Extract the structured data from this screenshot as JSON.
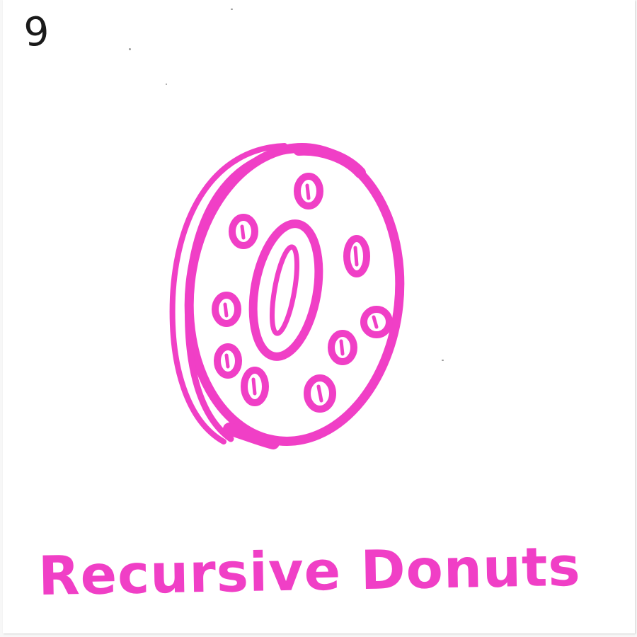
{
  "card": {
    "number": "9",
    "caption": "Recursive Donuts"
  },
  "ink_color": "#f03fc6",
  "pencil_color": "#1a1a1a",
  "icons": {
    "drawing": "donut-icon"
  }
}
